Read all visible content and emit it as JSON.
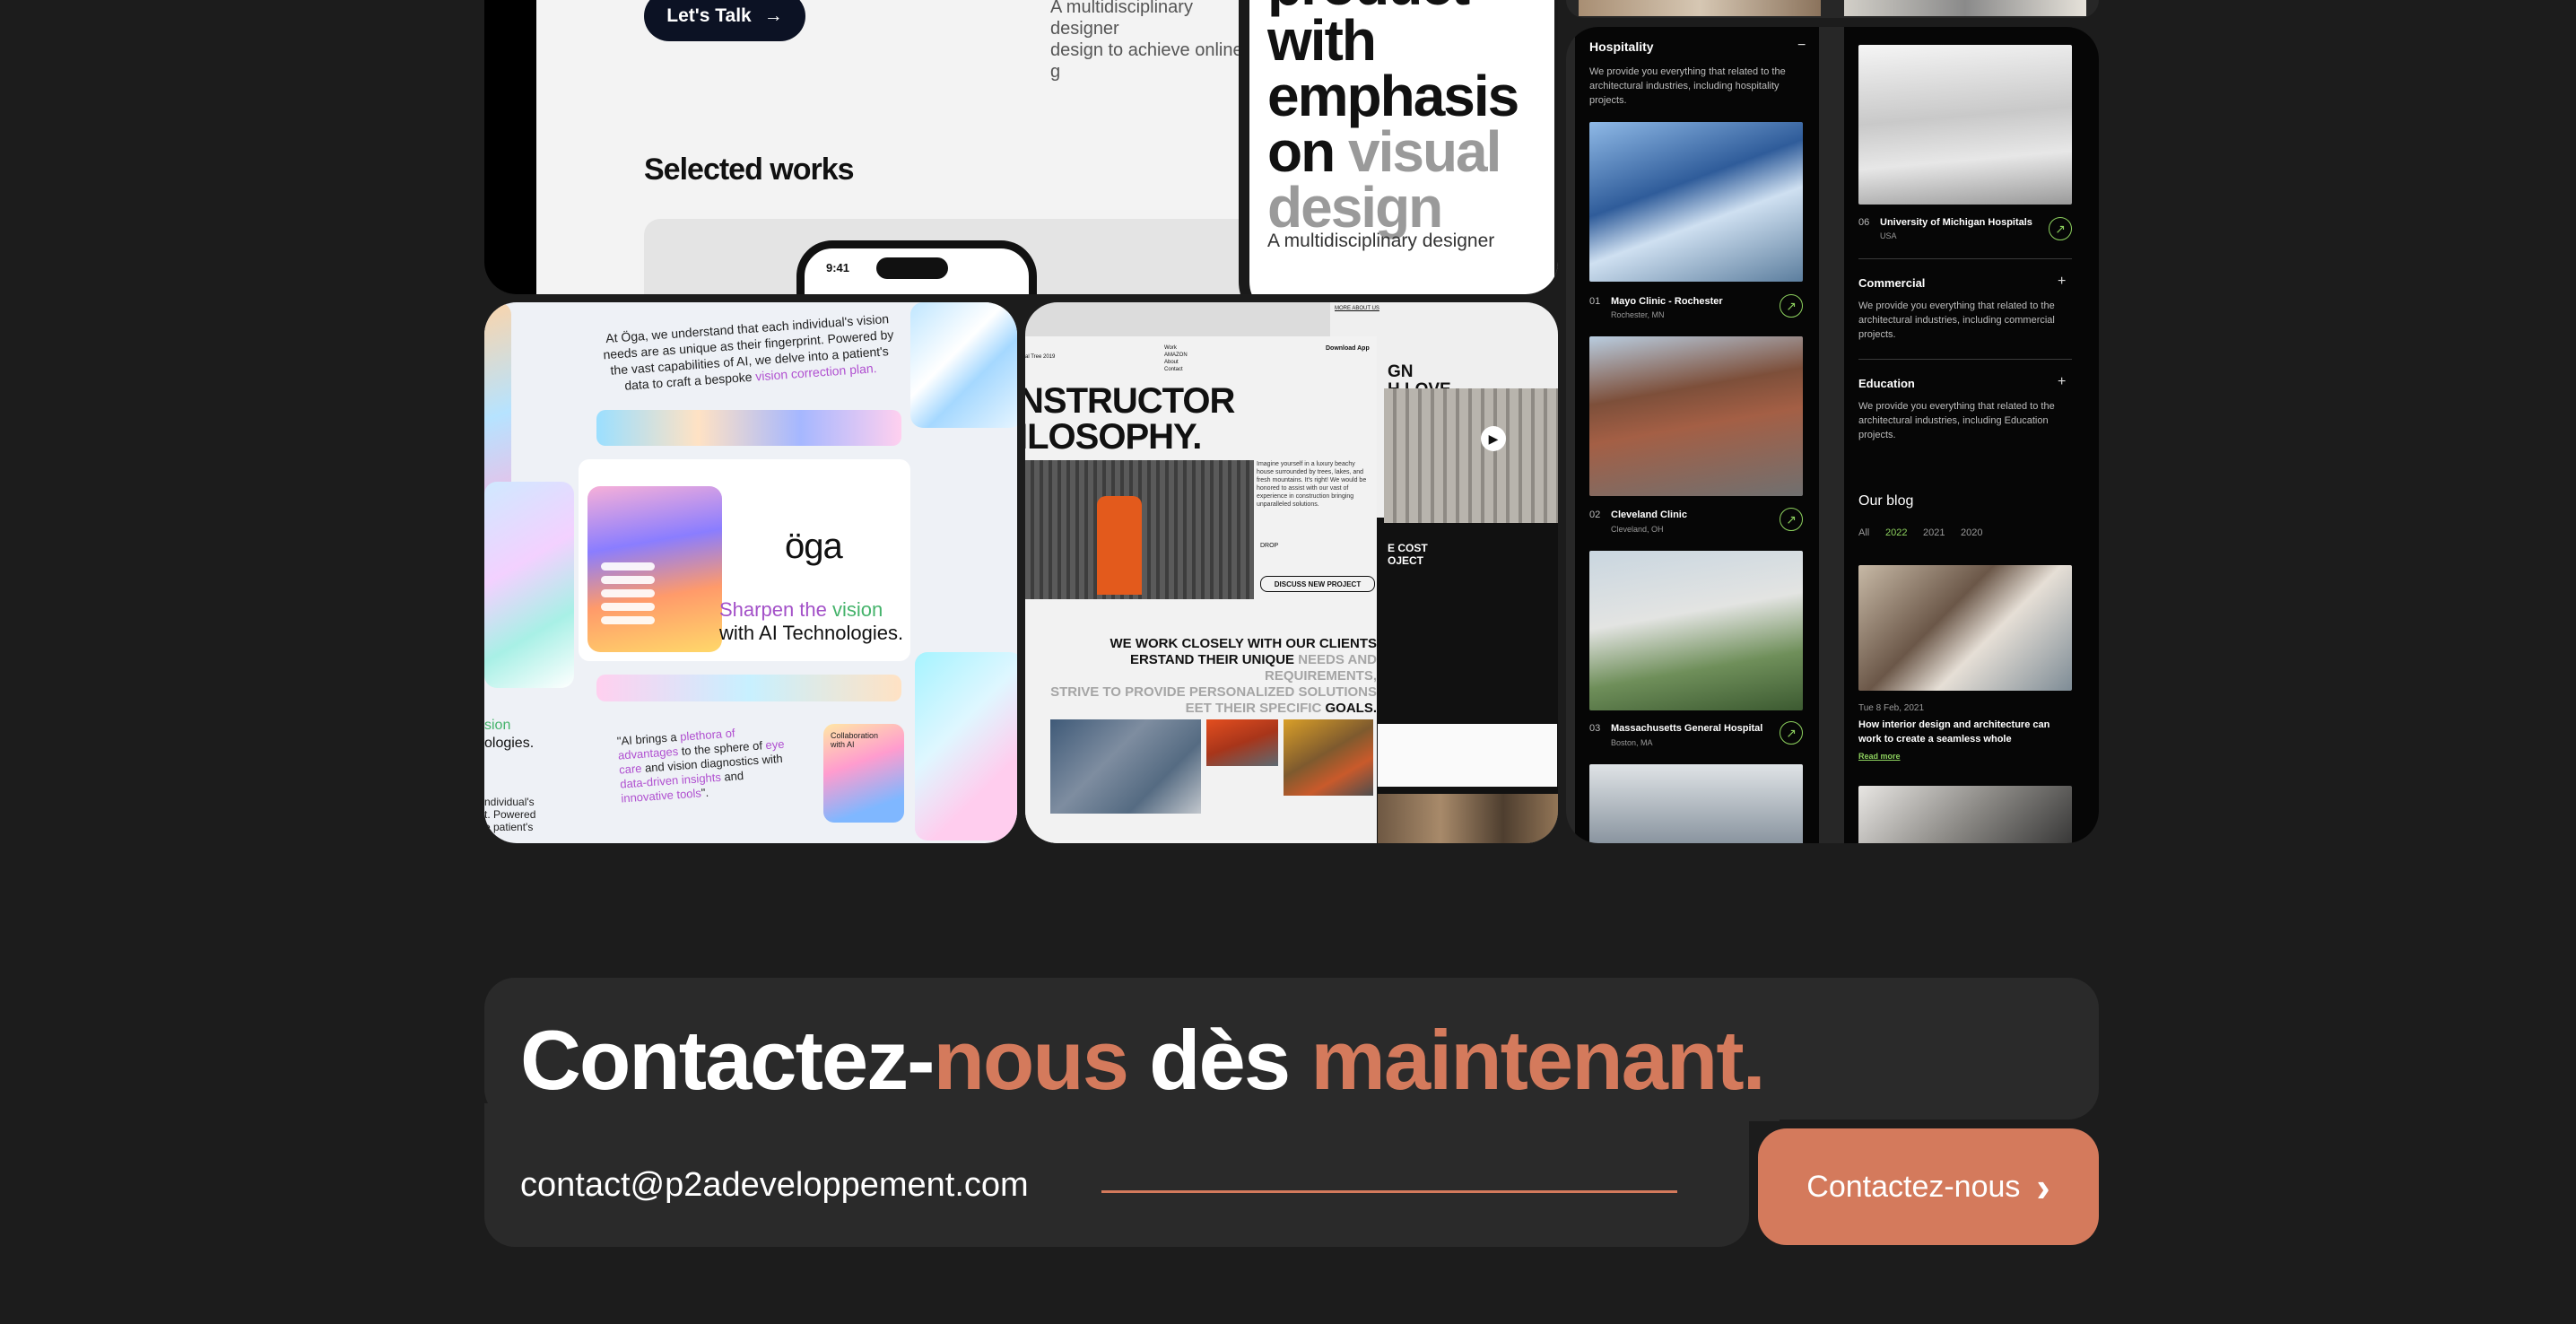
{
  "portfolio": {
    "lets_talk": "Let's Talk",
    "arrow": "→",
    "description": "A multidisciplinary designer\ndesign to achieve online g",
    "selected_works": "Selected works",
    "phone_time": "9:41",
    "phone_headline_1": "product",
    "phone_headline_2": "with",
    "phone_headline_3": "emphasis",
    "phone_headline_4": "on ",
    "phone_headline_5": "visual",
    "phone_headline_6": "design",
    "phone_subtext": "A multidisciplinary designer"
  },
  "oga": {
    "top_text_1": "At Öga, we understand that ",
    "top_text_2": "each",
    "top_text_3": " individual's vision ",
    "top_text_4": "needs",
    "top_text_5": " are as ",
    "top_text_6": "unique",
    "top_text_7": " as their fingerprint. Powered by the vast capabilities of AI, ",
    "top_text_8": "we delve into",
    "top_text_9": " a patient's ",
    "top_text_10": "data to craft",
    "top_text_11": " a bespoke ",
    "top_text_12": "vision correction plan.",
    "brand": "öga",
    "sharpen_1": "Sharpen the ",
    "sharpen_2": "vision",
    "sharpen_3": "with AI Technologies.",
    "bottom_text_1": "\"AI brings a ",
    "bottom_text_2": "plethora of advantages",
    "bottom_text_3": " to the sphere of ",
    "bottom_text_4": "eye care",
    "bottom_text_5": " and vision diagnostics with ",
    "bottom_text_6": "data-driven insights",
    "bottom_text_7": " and ",
    "bottom_text_8": "innovative tools",
    "bottom_text_9": "\".",
    "collab": "Collaboration with AI",
    "left_text_1": "sion",
    "left_text_2": "ologies.",
    "left_small": "ndividual's\nt. Powered\ne patient's"
  },
  "constructor": {
    "tag": "al Tree 2019",
    "nav": "Work\nAMAZON\nAbout\nContact",
    "download": "Download App",
    "title": "NSTRUCTOR\nILOSOPHY.",
    "paragraph": "Imagine yourself in a luxury beachy house surrounded by trees, lakes, and fresh mountains. It's right! We would be honored to assist with our vast of experience in construction bringing unparalleled solutions.",
    "drop": "DROP",
    "discuss": "DISCUSS NEW PROJECT",
    "work_1": "WE WORK CLOSELY WITH OUR CLIENTS",
    "work_2": "ERSTAND THEIR UNIQUE ",
    "work_3": "NEEDS AND REQUIREMENTS,",
    "work_4": " STRIVE TO PROVIDE PERSONALIZED SOLUTIONS",
    "work_5": "EET THEIR SPECIFIC ",
    "work_6": "GOALS.",
    "right_title": "GN\nH LOVE",
    "more": "MORE ABOUT US",
    "cost": "E COST\nOJECT"
  },
  "hospitals": {
    "category_1": "Hospitality",
    "category_1_toggle": "−",
    "category_1_desc": "We provide you everything that related to the architectural industries, including hospitality projects.",
    "items": [
      {
        "num": "01",
        "name": "Mayo Clinic - Rochester",
        "loc": "Rochester, MN"
      },
      {
        "num": "02",
        "name": "Cleveland Clinic",
        "loc": "Cleveland, OH"
      },
      {
        "num": "03",
        "name": "Massachusetts General Hospital",
        "loc": "Boston, MA"
      }
    ],
    "item_06_num": "06",
    "item_06_name": "University of Michigan Hospitals",
    "item_06_loc": "USA",
    "commercial": "Commercial",
    "commercial_desc": "We provide you everything that related to the architectural industries, including commercial projects.",
    "education": "Education",
    "education_desc": "We provide you everything that related to the architectural industries, including Education projects.",
    "plus": "+",
    "arrow": "↗",
    "blog_title": "Our blog",
    "blog_tabs": [
      "All",
      "2022",
      "2021",
      "2020"
    ],
    "blog_date": "Tue 8 Feb, 2021",
    "blog_post": "How interior design and architecture can work to create a seamless whole",
    "read_more": "Read more"
  },
  "contact": {
    "headline_1": "Contactez-",
    "headline_2": "nous",
    "headline_3": " dès ",
    "headline_4": "maintenant.",
    "email": "contact@p2adeveloppement.com",
    "button_label": "Contactez-nous",
    "button_icon": "›"
  },
  "colors": {
    "accent": "#d47a5c",
    "background": "#1c1c1c",
    "panel": "#2a2a2a",
    "green": "#8dd15e"
  }
}
